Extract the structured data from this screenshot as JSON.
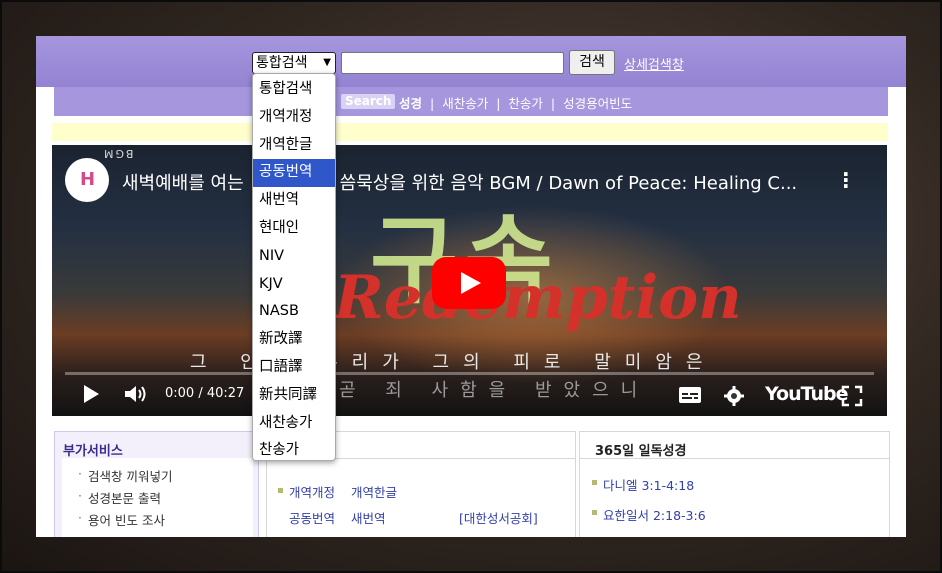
{
  "search": {
    "scope_selected": "통합검색",
    "query_value": "",
    "button_label": "검색",
    "advanced_link": "상세검색창"
  },
  "subnav": {
    "badge": "Search",
    "items": [
      "성경",
      "새찬송가",
      "찬송가",
      "성경용어빈도"
    ],
    "separator": "|"
  },
  "dropdown": {
    "options": [
      "통합검색",
      "개역개정",
      "개역한글",
      "공동번역",
      "새번역",
      "현대인",
      "NIV",
      "KJV",
      "NASB",
      "新改譯",
      "口語譯",
      "新共同譯",
      "새찬송가",
      "찬송가"
    ],
    "highlighted_index": 3,
    "highlighted_label": "공동번역"
  },
  "video": {
    "title_visible_part1": "새벽예배를 여는",
    "title_visible_part2": "씀묵상을 위한 음악 BGM / Dawn of Peace: Healing C...",
    "channel_tag": "BGM",
    "logo_letter": "H",
    "overlay_korean": "구속",
    "overlay_english": "Redemption",
    "subtitle_line1": "그 안에 우리가 그의 피로 말미암은",
    "subtitle_line2": "곧 죄 사함을 받았으니",
    "time": "0:00 / 40:27",
    "youtube_label": "YouTube",
    "icons": {
      "play": "play-icon",
      "volume": "volume-icon",
      "captions": "captions-icon",
      "settings": "gear-icon",
      "fullscreen": "fullscreen-icon",
      "more": "more-vertical-icon"
    },
    "play_color": "#ff0000"
  },
  "panels": {
    "extra_services": {
      "title": "부가서비스",
      "items": [
        "검색창 끼워넣기",
        "성경본문 출력",
        "용어 빈도 조사"
      ]
    },
    "bible_versions": {
      "title_visible": "경",
      "links_row1": [
        "개역개정",
        "개역한글"
      ],
      "links_row2": [
        "공동번역",
        "새번역"
      ],
      "publisher": "[대한성서공회]"
    },
    "daily_reading": {
      "title": "365일 일독성경",
      "items": [
        "다니엘 3:1-4:18",
        "요한일서 2:18-3:6"
      ]
    }
  },
  "colors": {
    "header_purple": "#9483d2",
    "subnav_purple": "#a596de",
    "link_blue": "#3340a8",
    "highlight_blue": "#2f57c9",
    "yellow_bar": "#ffffcc"
  }
}
